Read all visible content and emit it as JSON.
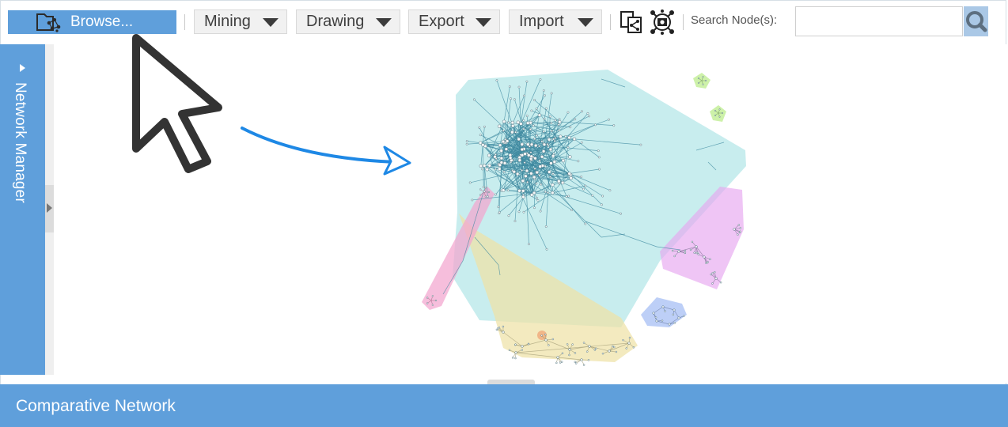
{
  "toolbar": {
    "browse_label": "Browse...",
    "menus": [
      "Mining",
      "Drawing",
      "Export",
      "Import"
    ],
    "icons": [
      "share-network-icon",
      "network-snapshot-icon"
    ],
    "search_label": "Search Node(s):",
    "search_value": "",
    "search_icon": "magnifier-icon"
  },
  "side_panel": {
    "label": "Network Manager"
  },
  "footer": {
    "title": "Comparative Network"
  },
  "colors": {
    "accent": "#5f9fdb",
    "cluster_cyan": "#9adfe0",
    "cluster_yellow": "#efe2a6",
    "cluster_pink": "#f3a5cf",
    "cluster_magenta": "#e7a6f0",
    "cluster_blue": "#a7bff4",
    "cluster_green": "#c8f0a0",
    "arrow_blue": "#1e88e5"
  }
}
